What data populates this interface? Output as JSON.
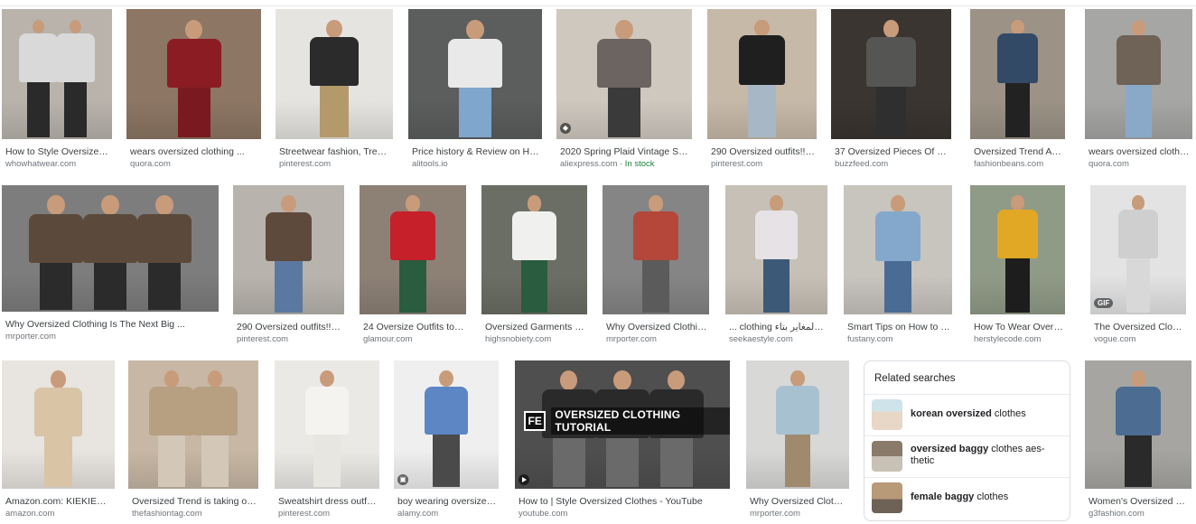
{
  "results": [
    {
      "caption": "How to Style Oversize Cl...",
      "source": "whowhatwear.com",
      "badge": ""
    },
    {
      "caption": "wears oversized clothing ...",
      "source": "quora.com",
      "badge": ""
    },
    {
      "caption": "Streetwear fashion, Trend...",
      "source": "pinterest.com",
      "badge": ""
    },
    {
      "caption": "Price history & Review on Hoo...",
      "source": "alitools.io",
      "badge": ""
    },
    {
      "caption": "2020 Spring Plaid Vintage Shirt...",
      "source": "aliexpress.com",
      "stock": " · In stock",
      "badge": ""
    },
    {
      "caption": "290 Oversized outfits!!! i...",
      "source": "pinterest.com",
      "badge": ""
    },
    {
      "caption": "37 Oversized Pieces Of Clo...",
      "source": "buzzfeed.com",
      "badge": ""
    },
    {
      "caption": "Oversized Trend And St...",
      "source": "fashionbeans.com",
      "badge": ""
    },
    {
      "caption": "wears oversized clothin...",
      "source": "quora.com",
      "badge": ""
    },
    {
      "caption": "Why Oversized Clothing Is The Next Big ...",
      "source": "mrporter.com",
      "badge": ""
    },
    {
      "caption": "290 Oversized outfits!!! i...",
      "source": "pinterest.com",
      "badge": ""
    },
    {
      "caption": "24 Oversize Outfits to W...",
      "source": "glamour.com",
      "badge": ""
    },
    {
      "caption": "Oversized Garments M...",
      "source": "highsnobiety.com",
      "badge": ""
    },
    {
      "caption": "Why Oversized Clothing ...",
      "source": "mrporter.com",
      "badge": ""
    },
    {
      "caption": "... clothing النزعة المغاير بتاء",
      "source": "seekaestyle.com",
      "badge": ""
    },
    {
      "caption": "Smart Tips on How to St...",
      "source": "fustany.com",
      "badge": ""
    },
    {
      "caption": "How To Wear Oversize...",
      "source": "herstylecode.com",
      "badge": ""
    },
    {
      "caption": "The Oversized Clothes ...",
      "source": "vogue.com",
      "badge": "GIF"
    },
    {
      "caption": "Amazon.com: KIEKIECO...",
      "source": "amazon.com",
      "badge": ""
    },
    {
      "caption": "Oversized Trend is taking over...",
      "source": "thefashiontag.com",
      "badge": ""
    },
    {
      "caption": "Sweatshirt dress outfit...",
      "source": "pinterest.com",
      "badge": ""
    },
    {
      "caption": "boy wearing oversized ...",
      "source": "alamy.com",
      "badge": ""
    },
    {
      "caption": "How to | Style Oversized Clothes - YouTube",
      "source": "youtube.com",
      "badge": "",
      "video_title": "OVERSIZED CLOTHING TUTORIAL",
      "video_logo": "FE"
    },
    {
      "caption": "Why Oversized Clothin...",
      "source": "mrporter.com",
      "badge": ""
    },
    {
      "caption": "Women's Oversized Clo...",
      "source": "g3fashion.com",
      "badge": ""
    }
  ],
  "related": {
    "title": "Related searches",
    "items": [
      {
        "bold": "korean oversized",
        "rest": " clothes"
      },
      {
        "bold": "oversized baggy",
        "rest": " clothes aes-thetic"
      },
      {
        "bold": "female baggy",
        "rest": " clothes"
      }
    ]
  },
  "colors": {
    "accent_stock": "#188038",
    "caption": "#3c4043",
    "source": "#70757a"
  }
}
